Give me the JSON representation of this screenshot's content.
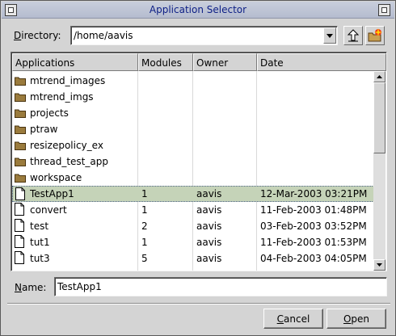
{
  "window": {
    "title": "Application Selector"
  },
  "directory": {
    "label": "Directory:",
    "value": "/home/aavis"
  },
  "list": {
    "columns": [
      "Applications",
      "Modules",
      "Owner",
      "Date"
    ],
    "rows": [
      {
        "type": "folder",
        "name": "mtrend_images",
        "modules": "",
        "owner": "",
        "date": ""
      },
      {
        "type": "folder",
        "name": "mtrend_imgs",
        "modules": "",
        "owner": "",
        "date": ""
      },
      {
        "type": "folder",
        "name": "projects",
        "modules": "",
        "owner": "",
        "date": ""
      },
      {
        "type": "folder",
        "name": "ptraw",
        "modules": "",
        "owner": "",
        "date": ""
      },
      {
        "type": "folder",
        "name": "resizepolicy_ex",
        "modules": "",
        "owner": "",
        "date": ""
      },
      {
        "type": "folder",
        "name": "thread_test_app",
        "modules": "",
        "owner": "",
        "date": ""
      },
      {
        "type": "folder",
        "name": "workspace",
        "modules": "",
        "owner": "",
        "date": ""
      },
      {
        "type": "file",
        "name": "TestApp1",
        "modules": "1",
        "owner": "aavis",
        "date": "12-Mar-2003 03:21PM",
        "selected": true
      },
      {
        "type": "file",
        "name": "convert",
        "modules": "1",
        "owner": "aavis",
        "date": "11-Feb-2003 01:48PM"
      },
      {
        "type": "file",
        "name": "test",
        "modules": "2",
        "owner": "aavis",
        "date": "03-Feb-2003 03:52PM"
      },
      {
        "type": "file",
        "name": "tut1",
        "modules": "1",
        "owner": "aavis",
        "date": "11-Feb-2003 01:53PM"
      },
      {
        "type": "file",
        "name": "tut3",
        "modules": "5",
        "owner": "aavis",
        "date": "04-Feb-2003 04:05PM"
      }
    ]
  },
  "name_field": {
    "label": "Name:",
    "value": "TestApp1"
  },
  "buttons": {
    "cancel": "Cancel",
    "open": "Open"
  },
  "colors": {
    "title_text": "#0c1e85",
    "selection": "#c5d3b8",
    "folder": "#9a7b3d"
  },
  "icons": [
    "window-menu-icon",
    "close-window-icon",
    "dropdown-arrow-icon",
    "up-directory-icon",
    "new-folder-icon",
    "folder-icon",
    "file-icon",
    "scroll-up-icon",
    "scroll-down-icon"
  ]
}
